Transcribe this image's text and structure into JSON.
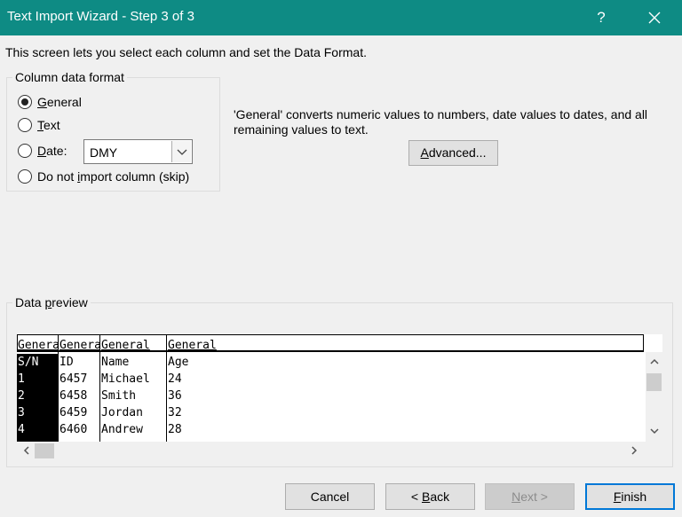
{
  "window": {
    "title": "Text Import Wizard - Step 3 of 3",
    "help": "?"
  },
  "intro": "This screen lets you select each column and set the Data Format.",
  "format_group": {
    "legend": "Column data format",
    "options": [
      {
        "pre": "",
        "key": "G",
        "post": "eneral",
        "checked": true
      },
      {
        "pre": "",
        "key": "T",
        "post": "ext",
        "checked": false
      },
      {
        "pre": "",
        "key": "D",
        "post": "ate:",
        "checked": false
      },
      {
        "pre": "Do not ",
        "key": "i",
        "post": "mport column (skip)",
        "checked": false
      }
    ],
    "date_value": "DMY"
  },
  "description": "'General' converts numeric values to numbers, date values to dates, and all remaining values to text.",
  "advanced": {
    "key": "A",
    "rest": "dvanced..."
  },
  "preview": {
    "legend_pre": "Data ",
    "legend_key": "p",
    "legend_post": "review",
    "header": [
      "General",
      "General",
      "General",
      "General"
    ],
    "rows": [
      [
        "S/N",
        "ID",
        "Name",
        "Age"
      ],
      [
        "1",
        "6457",
        "Michael",
        "24"
      ],
      [
        "2",
        "6458",
        "Smith",
        "36"
      ],
      [
        "3",
        "6459",
        "Jordan",
        "32"
      ],
      [
        "4",
        "6460",
        "Andrew",
        "28"
      ]
    ]
  },
  "buttons": {
    "cancel": "Cancel",
    "back_pre": "< ",
    "back_key": "B",
    "back_post": "ack",
    "next_pre": "",
    "next_key": "N",
    "next_post": "ext >",
    "finish_key": "F",
    "finish_post": "inish"
  }
}
